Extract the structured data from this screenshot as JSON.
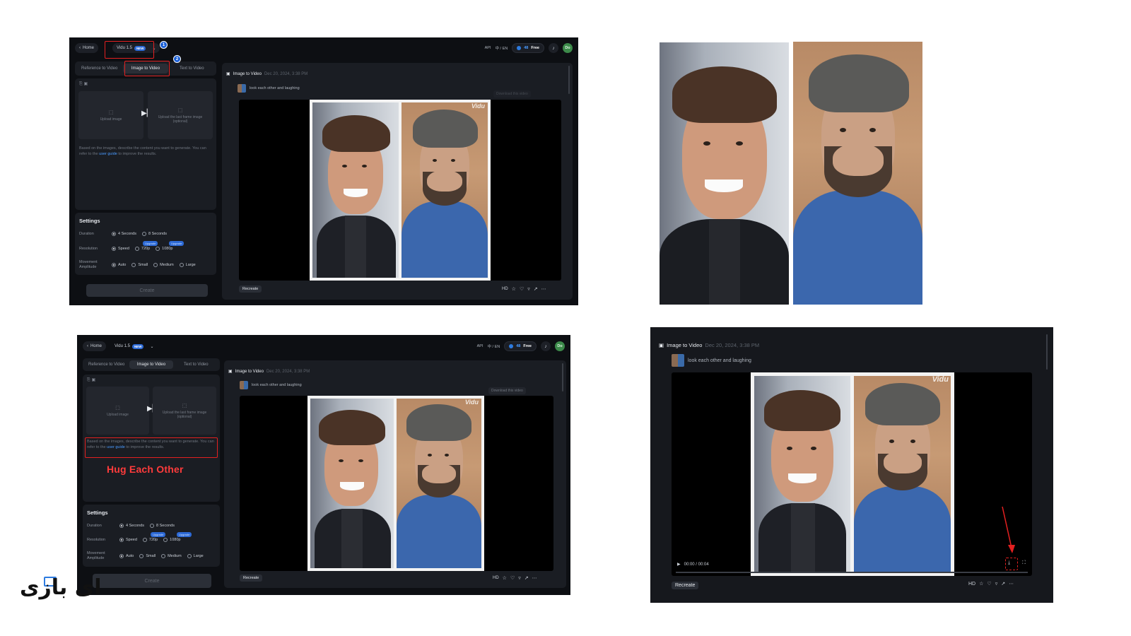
{
  "top_bar": {
    "home_label": "Home",
    "model_label": "Vidu 1.5",
    "new_badge": "NEW",
    "api_label": "API",
    "lang_label": "中 / EN",
    "credits": "48",
    "plan": "Free",
    "avatar_initials": "Do"
  },
  "tabs": [
    "Reference to Video",
    "Image to Video",
    "Text to Video"
  ],
  "upload": {
    "first_frame": "Upload image",
    "last_frame": "Upload the last frame image (optional)"
  },
  "prompt_hint": {
    "text_before": "Based on the images, describe the content you want to generate. You can refer to the",
    "link": "user guide",
    "text_after": "to improve the results."
  },
  "settings": {
    "title": "Settings",
    "duration_label": "Duration",
    "duration_options": [
      "4 Seconds",
      "8 Seconds"
    ],
    "resolution_label": "Resolution",
    "resolution_options": [
      "Speed",
      "720p",
      "1080p"
    ],
    "upgrade_badge": "Upgrade",
    "movement_label": "Movement Amplitude",
    "movement_options": [
      "Auto",
      "Small",
      "Medium",
      "Large"
    ]
  },
  "create_label": "Create",
  "result": {
    "title": "Image to Video",
    "date": "Dec 20, 2024, 3:38 PM",
    "prompt": "look each other and laughing",
    "download_hint": "Download this video",
    "watermark": "Vidu",
    "recreate_label": "Recreate",
    "hd_label": "HD",
    "time": "00:00 / 00:04"
  },
  "annotations": {
    "step1": "1",
    "step2": "2",
    "hug_text": "Hug Each Other"
  },
  "logo_text": "ای بازی",
  "colors": {
    "app_bg": "#0d0f13",
    "panel_bg": "#1a1d23",
    "accent_blue": "#2d7be0",
    "annotation_red": "#e32020"
  }
}
